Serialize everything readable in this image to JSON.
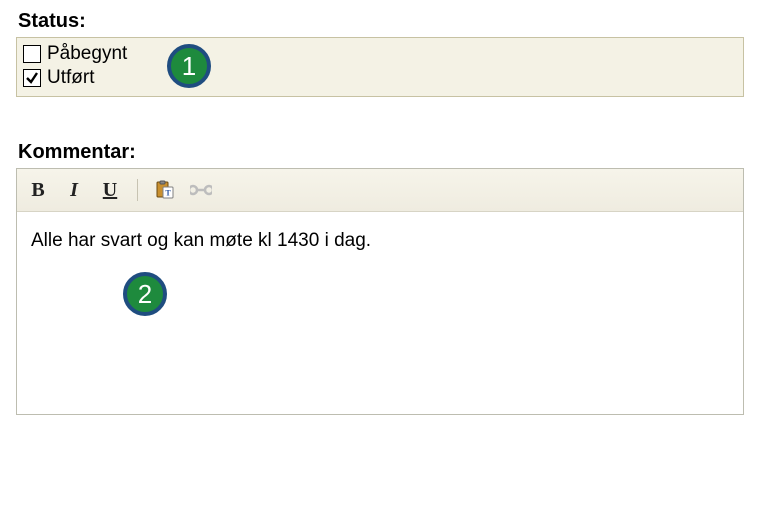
{
  "status": {
    "label": "Status:",
    "options": [
      {
        "label": "Påbegynt",
        "checked": false
      },
      {
        "label": "Utført",
        "checked": true
      }
    ]
  },
  "comment": {
    "label": "Kommentar:",
    "toolbar": {
      "bold": "B",
      "italic": "I",
      "underline": "U"
    },
    "text": "Alle har svart og kan møte kl 1430 i dag."
  },
  "callouts": {
    "one": "1",
    "two": "2"
  }
}
